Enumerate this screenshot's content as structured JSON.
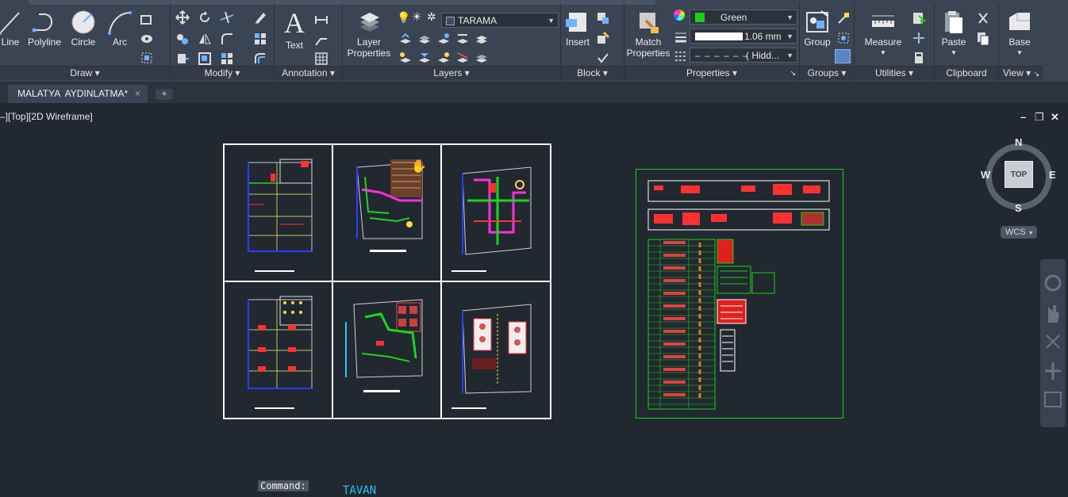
{
  "ribbon": {
    "panels": {
      "draw": "Draw",
      "modify": "Modify",
      "annotation": "Annotation",
      "layers": "Layers",
      "block": "Block",
      "properties": "Properties",
      "groups": "Groups",
      "utilities": "Utilities",
      "clipboard": "Clipboard",
      "view": "View"
    },
    "draw_tools": [
      "Line",
      "Polyline",
      "Circle",
      "Arc"
    ],
    "annotation_tools": {
      "text": "Text"
    },
    "layer_tools": {
      "layer_properties": "Layer Properties",
      "current_layer": "TARAMA"
    },
    "block_tools": {
      "insert": "Insert"
    },
    "properties_tools": {
      "match_properties": "Match Properties",
      "color": "Green",
      "lineweight": "1.06 mm",
      "linetype": "( Hidd..."
    },
    "groups_tools": {
      "group": "Group"
    },
    "utilities_tools": {
      "measure": "Measure"
    },
    "clipboard_tools": {
      "paste": "Paste"
    },
    "view_tools": {
      "base": "Base"
    }
  },
  "doc_tab": {
    "title": "MALATYA  AYDINLATMA*",
    "close": "×",
    "new_tab": "+"
  },
  "viewport": {
    "label": "–][Top][2D Wireframe]",
    "controls": {
      "minimize": "–",
      "restore": "❐",
      "close": "✕"
    }
  },
  "viewcube": {
    "north": "N",
    "south": "S",
    "east": "E",
    "west": "W",
    "face": "TOP",
    "wcs": "WCS"
  },
  "command": {
    "label": "Command:",
    "value": "TAVAN"
  },
  "colors": {
    "accent_green": "#19d019",
    "ribbon_bg": "#3b4453",
    "canvas_bg": "#212830",
    "cmd_text": "#29c4f0"
  }
}
